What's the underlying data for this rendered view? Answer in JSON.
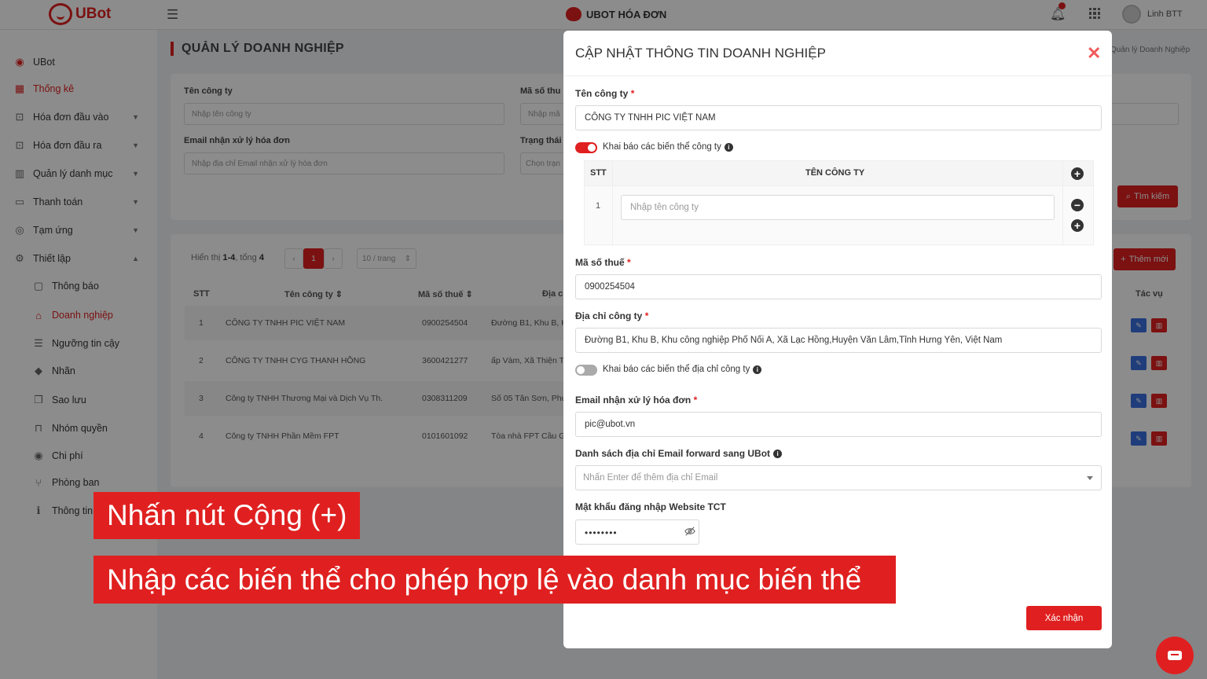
{
  "topbar": {
    "logo_text": "UBot",
    "app_title": "UBOT HÓA ĐƠN",
    "user_name": "Linh BTT"
  },
  "sidebar": {
    "items": [
      {
        "label": "UBot",
        "icon": "ubot-logo-icon"
      },
      {
        "label": "Thống kê",
        "icon": "dashboard-icon",
        "active": true
      },
      {
        "label": "Hóa đơn đầu vào",
        "icon": "invoice-in-icon"
      },
      {
        "label": "Hóa đơn đầu ra",
        "icon": "invoice-out-icon"
      },
      {
        "label": "Quản lý danh mục",
        "icon": "catalog-icon"
      },
      {
        "label": "Thanh toán",
        "icon": "card-icon"
      },
      {
        "label": "Tạm ứng",
        "icon": "advance-icon"
      },
      {
        "label": "Thiết lập",
        "icon": "gear-icon"
      }
    ],
    "sub_items": [
      {
        "label": "Thông báo",
        "icon": "bell-icon"
      },
      {
        "label": "Doanh nghiệp",
        "icon": "home-icon",
        "active": true
      },
      {
        "label": "Ngưỡng tin cậy",
        "icon": "sliders-icon"
      },
      {
        "label": "Nhãn",
        "icon": "tag-icon"
      },
      {
        "label": "Sao lưu",
        "icon": "copy-icon"
      },
      {
        "label": "Nhóm quyền",
        "icon": "lock-icon"
      },
      {
        "label": "Chi phí",
        "icon": "coin-icon"
      },
      {
        "label": "Phòng ban",
        "icon": "branch-icon"
      },
      {
        "label": "Thông tin",
        "icon": "info-icon"
      }
    ]
  },
  "page": {
    "title": "QUẢN LÝ DOANH NGHIỆP",
    "breadcrumb": "Quản lý Doanh Nghiệp",
    "filter": {
      "company_label": "Tên công ty",
      "company_placeholder": "Nhập tên công ty",
      "tax_label": "Mã số thu",
      "tax_placeholder": "Nhập mã",
      "email_label": "Email nhận xử lý hóa đơn",
      "email_placeholder": "Nhập địa chỉ Email nhận xử lý hóa đơn",
      "status_label": "Trạng thái",
      "status_placeholder": "Chọn trạn",
      "search_button": "Tìm kiếm"
    },
    "list": {
      "summary_prefix": "Hiển thị ",
      "summary_range": "1-4",
      "summary_mid": ", tổng ",
      "summary_total": "4",
      "current_page": "1",
      "page_size": "10 / trang",
      "add_button": "Thêm mới",
      "columns": [
        "STT",
        "Tên công ty",
        "Mã số thuế",
        "Địa c",
        "Tác vụ"
      ],
      "rows": [
        {
          "stt": "1",
          "name": "CÔNG TY TNHH PIC VIỆT NAM",
          "tax": "0900254504",
          "address": "Đường B1, Khu B, Kh"
        },
        {
          "stt": "2",
          "name": "CÔNG TY TNHH CYG THANH HỒNG",
          "tax": "3600421277",
          "address": "ấp Vàm, Xã Thiện Tâ"
        },
        {
          "stt": "3",
          "name": "Công ty TNHH Thương Mại và Dịch Vụ Th...",
          "tax": "0308311209",
          "address": "Số 05 Tân Sơn, Phườ"
        },
        {
          "stt": "4",
          "name": "Công ty TNHH Phần Mềm FPT",
          "tax": "0101601092",
          "address": "Tòa nhà FPT Cầu Gi"
        }
      ]
    }
  },
  "modal": {
    "title": "CẬP NHẬT THÔNG TIN DOANH NGHIỆP",
    "company_label": "Tên công ty",
    "company_value": "CÔNG TY TNHH PIC VIỆT NAM",
    "variant_company_toggle": {
      "label": "Khai báo các biến thể công ty",
      "on": true
    },
    "variant_table": {
      "col_stt": "STT",
      "col_name": "TÊN CÔNG TY",
      "rows": [
        {
          "stt": "1",
          "placeholder": "Nhập tên công ty"
        }
      ]
    },
    "tax_label": "Mã số thuế",
    "tax_value": "0900254504",
    "address_label": "Địa chỉ công ty",
    "address_value": "Đường B1, Khu B, Khu công nghiệp Phố Nối A, Xã Lạc Hồng,Huyện Văn Lâm,Tỉnh Hưng Yên, Việt Nam",
    "variant_address_toggle": {
      "label": "Khai báo các biến thể địa chỉ công ty",
      "on": false
    },
    "email_label": "Email nhận xử lý hóa đơn",
    "email_value": "pic@ubot.vn",
    "forward_label": "Danh sách địa chỉ Email forward sang UBot",
    "forward_placeholder": "Nhấn Enter để thêm địa chỉ Email",
    "password_label": "Mật khẩu đăng nhập Website TCT",
    "password_value": "••••••••",
    "confirm_button": "Xác nhận",
    "required_mark": "*",
    "close_glyph": "✕"
  },
  "captions": [
    "Nhấn nút Cộng (+)",
    "Nhập các biến thể cho phép hợp lệ vào danh mục biến thể"
  ],
  "colors": {
    "accent": "#e02020",
    "overlay": "rgba(0,0,0,0.45)"
  }
}
